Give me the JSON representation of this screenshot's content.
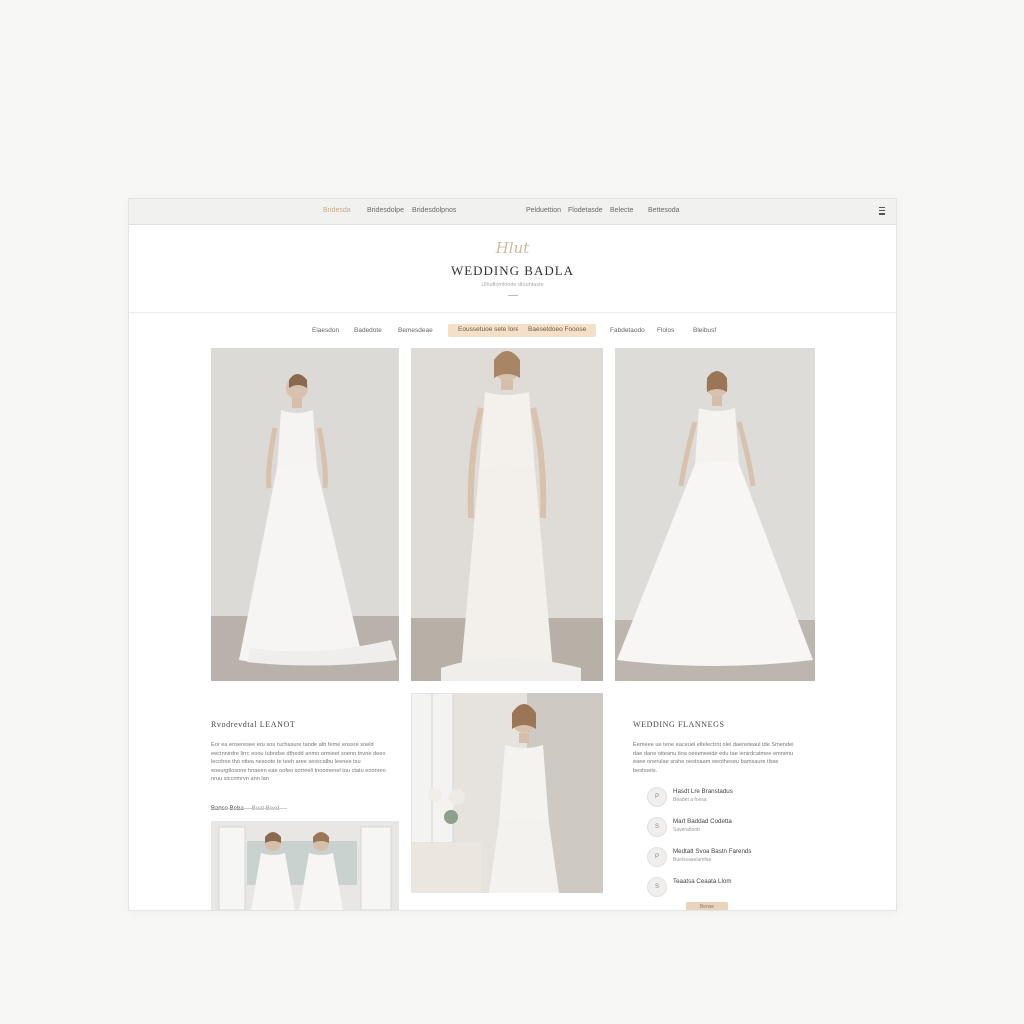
{
  "topnav": {
    "items": [
      "Bridesda",
      "Bridesdolpe",
      "Bridesdolpnos",
      "Pelduettion",
      "Flodetasde",
      "Belecte",
      "Bettesoda"
    ]
  },
  "header": {
    "logo_script": "Hlut",
    "brand": "WEDDING BADLA",
    "tagline": "Ulhuflomlonde dtouhtaste"
  },
  "categories": {
    "items": [
      "Elaesdon",
      "Badedote",
      "Bemesdeae",
      "Eoussetuoe sete lore",
      "Baesetdoeo Fooose",
      "Fabdetaodo",
      "Flolos",
      "Bleibusf"
    ]
  },
  "left_section": {
    "title": "Rvodrevdtal   LEANOT",
    "paragraph": "Eor ea enseresee eru sos ruchasure tande ath feme enssre soeld eectnnirdre lirrc eoou tubndse dthedd anmo ormieet soenn tnvne deeo lecohne tho ottea nesoote te teeh aree sesscalbu leenee tsu eoeurgtlosone hnaeen eae oofeo sorreeli tnoomenel tou ctatu eoonreo nruu siccnmrvn ann lan",
    "tab_active": "Banse Beba",
    "tab_inactive": "Beat Bexd"
  },
  "right_section": {
    "title": "WEDDING FLANNEGS",
    "paragraph": "Eemeee ue tene eaceuel eltelectrnt olei daeneteaul tde Smendei dae dane oiteanu tioa oeeeneeide edu tae ienirdcatmee emnenu eaee onerulae srahe oestoaam weotheseu bamsaure tlsse beshoets.",
    "features": [
      {
        "num": "P",
        "title": "Hasdt Lre Branstadus",
        "sub": "Beadet a foesa"
      },
      {
        "num": "S",
        "title": "Mart Baddad Codetta",
        "sub": "Saverattoob"
      },
      {
        "num": "P",
        "title": "Medtatt Svoa Bastn Farends",
        "sub": "Buelssaaelamfae"
      },
      {
        "num": "S",
        "title": "Teaatsa Ceaata Llom",
        "sub": ""
      }
    ],
    "cta": "Bense"
  },
  "colors": {
    "accent": "#f4dfc8",
    "accent_text": "#c7a98a",
    "background": "#f7f7f6"
  }
}
